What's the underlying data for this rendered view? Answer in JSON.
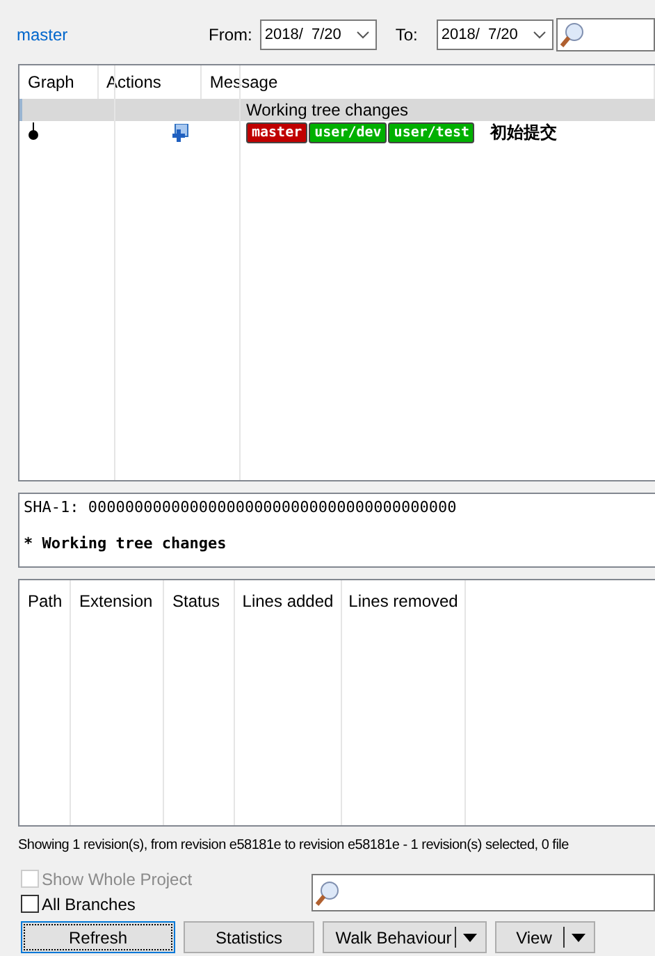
{
  "filter": {
    "branch": "master",
    "from_label": "From:",
    "from_value": "2018/  7/20",
    "to_label": "To:",
    "to_value": "2018/  7/20"
  },
  "log": {
    "columns": [
      "Graph",
      "Actions",
      "Message"
    ],
    "rows": [
      {
        "kind": "working_tree",
        "selected": true,
        "message": "Working tree changes"
      },
      {
        "kind": "commit",
        "selected": false,
        "refs": [
          {
            "name": "master",
            "color": "#c00000"
          },
          {
            "name": "user/dev",
            "color": "#00b000"
          },
          {
            "name": "user/test",
            "color": "#00b000"
          }
        ],
        "message": "初始提交"
      }
    ]
  },
  "detail": {
    "sha": "SHA-1: 0000000000000000000000000000000000000000",
    "subject": "* Working tree changes"
  },
  "files": {
    "columns": [
      "Path",
      "Extension",
      "Status",
      "Lines added",
      "Lines removed"
    ]
  },
  "status_bar": "Showing 1 revision(s), from revision e58181e to revision e58181e - 1 revision(s) selected, 0 file",
  "options": [
    {
      "label": "Show Whole Project",
      "checked": false,
      "disabled": true
    },
    {
      "label": "All Branches",
      "checked": false,
      "disabled": false
    }
  ],
  "buttons": [
    {
      "label": "Refresh",
      "kind": "plain",
      "focused": true
    },
    {
      "label": "Statistics",
      "kind": "plain",
      "focused": false
    },
    {
      "label": "Walk Behaviour",
      "kind": "split"
    },
    {
      "label": "View",
      "kind": "split"
    }
  ]
}
